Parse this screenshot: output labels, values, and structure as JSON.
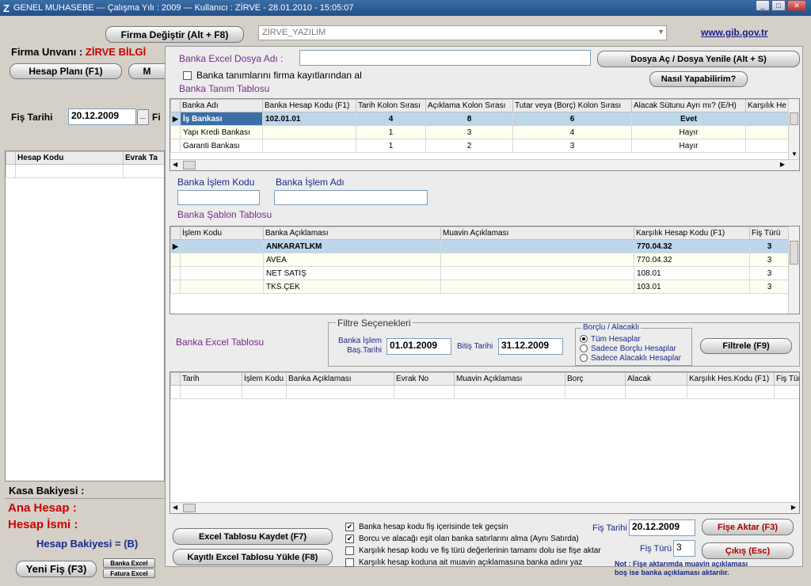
{
  "window": {
    "title": "GENEL MUHASEBE  ---  Çalışma Yılı : 2009  ---  Kullanıcı : ZİRVE - 28.01.2010 - 15:05:07",
    "logo": "Z"
  },
  "top": {
    "firma_degistir": "Firma Değiştir (Alt + F8)",
    "firma_select": "ZİRVE_YAZILIM",
    "gib_link": "www.gib.gov.tr"
  },
  "left": {
    "firma_unvani_label": "Firma Unvanı :",
    "firma_unvani_value": "ZİRVE BİLGİ",
    "hesap_plani": "Hesap Planı (F1)",
    "m_btn": "M",
    "fis_tarihi_label": "Fiş Tarihi",
    "fis_tarihi_value": "20.12.2009",
    "dots": "...",
    "fi_cut": "Fi",
    "cols": [
      "Hesap Kodu",
      "Evrak Ta"
    ],
    "kasa_bakiyesi": "Kasa Bakiyesi  :",
    "ana_hesap": "Ana Hesap :",
    "hesap_ismi": "Hesap İsmi :",
    "hesap_bakiyesi": "Hesap Bakiyesi = (B)",
    "yeni_fis": "Yeni Fiş (F3)",
    "banka_excel": "Banka Excel",
    "fatura_excel": "Fatura Excel"
  },
  "panel": {
    "dosya_adi_label": "Banka Excel Dosya Adı :",
    "dosya_ac": "Dosya Aç / Dosya Yenile (Alt + S)",
    "nasil": "Nasıl Yapabilirim?",
    "firma_kayit_chk": "Banka tanımlarını firma kayıtlarından al",
    "tanim_title": "Banka Tanım Tablosu",
    "tanim_cols": [
      "Banka Adı",
      "Banka Hesap Kodu (F1)",
      "Tarih Kolon Sırası",
      "Açıklama Kolon Sırası",
      "Tutar veya (Borç) Kolon Sırası",
      "Alacak Sütunu Ayrı mı? (E/H)",
      "Karşılık He"
    ],
    "tanim_rows": [
      {
        "ad": "İş Bankası",
        "kod": "102.01.01",
        "tarih": "4",
        "aciklama": "8",
        "tutar": "6",
        "alacak": "Evet"
      },
      {
        "ad": "Yapı Kredi Bankası",
        "kod": "",
        "tarih": "1",
        "aciklama": "3",
        "tutar": "4",
        "alacak": "Hayır"
      },
      {
        "ad": "Garanti Bankası",
        "kod": "",
        "tarih": "1",
        "aciklama": "2",
        "tutar": "3",
        "alacak": "Hayır"
      }
    ],
    "islem_kodu_label": "Banka İşlem Kodu",
    "islem_adi_label": "Banka İşlem Adı",
    "sablon_title": "Banka Şablon Tablosu",
    "sablon_cols": [
      "İşlem Kodu",
      "Banka Açıklaması",
      "Muavin Açıklaması",
      "Karşılık Hesap Kodu (F1)",
      "Fiş Türü"
    ],
    "sablon_rows": [
      {
        "kod": "",
        "aciklama": "ANKARATLKM",
        "muavin": "",
        "karsilik": "770.04.32",
        "tur": "3"
      },
      {
        "kod": "",
        "aciklama": "AVEA",
        "muavin": "",
        "karsilik": "770.04.32",
        "tur": "3"
      },
      {
        "kod": "",
        "aciklama": "NET SATIŞ",
        "muavin": "",
        "karsilik": "108.01",
        "tur": "3"
      },
      {
        "kod": "",
        "aciklama": "TKS.ÇEK",
        "muavin": "",
        "karsilik": "103.01",
        "tur": "3"
      }
    ],
    "filtre_title": "Filtre Seçenekleri",
    "excel_tablosu_title": "Banka Excel Tablosu",
    "bas_tarihi_label1": "Banka İşlem",
    "bas_tarihi_label2": "Baş.Tarihi",
    "bas_tarihi": "01.01.2009",
    "bitis_label": "Bitiş Tarihi",
    "bitis_tarihi": "31.12.2009",
    "borclu_title": "Borçlu / Alacaklı",
    "radio_tum": "Tüm Hesaplar",
    "radio_borclu": "Sadece Borçlu Hesaplar",
    "radio_alacakli": "Sadece Alacaklı Hesaplar",
    "filtrele": "Filtrele (F9)",
    "excel_cols": [
      "Tarih",
      "İşlem Kodu",
      "Banka Açıklaması",
      "Evrak No",
      "Muavin Açıklaması",
      "Borç",
      "Alacak",
      "Karşılık Hes.Kodu (F1)",
      "Fiş Tür"
    ],
    "excel_kaydet": "Excel Tablosu Kaydet (F7)",
    "excel_yukle": "Kayıtlı Excel Tablosu Yükle (F8)",
    "chk1": "Banka hesap kodu fiş içerisinde tek geçsin",
    "chk2": "Borcu ve alacağı eşit olan banka satırlarını alma (Aynı Satırda)",
    "chk3": "Karşılık hesap kodu ve fiş türü değerlerinin tamamı dolu ise fişe aktar",
    "chk4": "Karşılık hesap koduna ait muavin açıklamasına banka adını yaz",
    "fis_tarihi_label": "Fiş Tarihi",
    "fis_tarihi": "20.12.2009",
    "fis_turu_label": "Fiş Türü",
    "fis_turu": "3",
    "fise_aktar": "Fişe Aktar (F3)",
    "cikis": "Çıkış (Esc)",
    "not1": "Not : Fişe aktarımda muavin açıklaması",
    "not2": "boş ise  banka açıklaması aktarılır."
  }
}
